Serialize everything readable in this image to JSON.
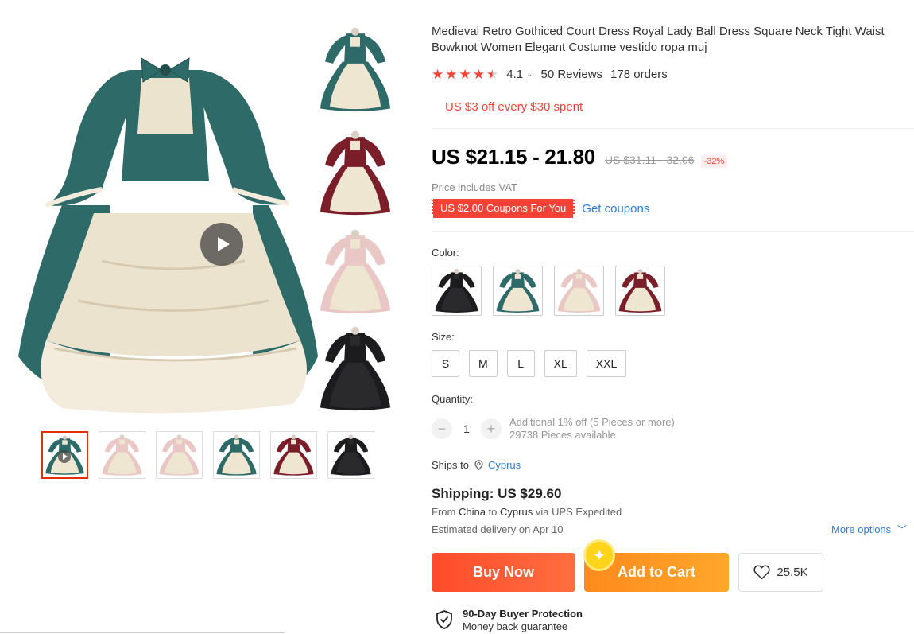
{
  "product": {
    "title": "Medieval Retro Gothiced Court Dress Royal Lady Ball Dress Square Neck Tight Waist Bowknot Women Elegant Costume vestido ropa muj",
    "rating": "4.1",
    "rating_value": 4.1,
    "reviews": "50 Reviews",
    "orders": "178 orders",
    "promo": "US $3 off every $30 spent",
    "price": "US $21.15 - 21.80",
    "old_price": "US $31.11 - 32.06",
    "discount": "-32%",
    "vat_note": "Price includes VAT",
    "coupon": "US $2.00 Coupons For You",
    "get_coupons": "Get coupons"
  },
  "gallery": {
    "main_icon": "play-icon",
    "side_colors": [
      "#2e6b68",
      "#7a1f2a",
      "#e9c7c4",
      "#1c1c1e"
    ],
    "thumb_colors": [
      "#2e6b68",
      "#e9c7c4",
      "#e9c7c4",
      "#2e6b68",
      "#7a1f2a",
      "#1c1c1e"
    ]
  },
  "options": {
    "color_label": "Color:",
    "colors": [
      "#1c1c1e",
      "#2e6b68",
      "#e9c7c4",
      "#7a1f2a"
    ],
    "size_label": "Size:",
    "sizes": [
      "S",
      "M",
      "L",
      "XL",
      "XXL"
    ],
    "quantity_label": "Quantity:",
    "quantity": "1",
    "minus": "−",
    "plus": "+",
    "bulk_note": "Additional 1% off (5 Pieces or more)",
    "available": "29738 Pieces available"
  },
  "shipping": {
    "ships_to_label": "Ships to",
    "country": "Cyprus",
    "cost": "Shipping: US $29.60",
    "from_prefix": "From",
    "from": "China",
    "to_prefix": "to",
    "to": "Cyprus",
    "via": "via UPS Expedited",
    "delivery": "Estimated delivery on Apr 10",
    "more_options": "More options"
  },
  "actions": {
    "buy_now": "Buy Now",
    "add_to_cart": "Add to Cart",
    "wishlist_count": "25.5K"
  },
  "protection": {
    "title": "90-Day Buyer Protection",
    "subtitle": "Money back guarantee"
  },
  "colors": {
    "accent": "#f44336",
    "link": "#2e7bd3",
    "buy": "#ff4b2b",
    "cart": "#ffa72b"
  }
}
